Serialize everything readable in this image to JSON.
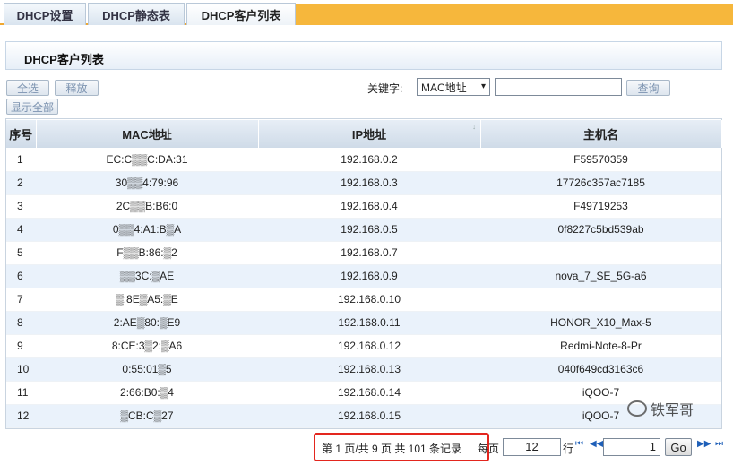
{
  "tabs": [
    "DHCP设置",
    "DHCP静态表",
    "DHCP客户列表"
  ],
  "panel_title": "DHCP客户列表",
  "toolbar": {
    "select_all": "全选",
    "release": "释放",
    "show_all": "显示全部",
    "keyword_label": "关键字:",
    "keyword_option": "MAC地址",
    "keyword_value": "",
    "query": "查询"
  },
  "table": {
    "headers": [
      "序号",
      "MAC地址",
      "IP地址",
      "主机名"
    ],
    "rows": [
      {
        "idx": "1",
        "mac": "EC:C▒▒C:DA:31",
        "ip": "192.168.0.2",
        "host": "F59570359"
      },
      {
        "idx": "2",
        "mac": "30▒▒4:79:96",
        "ip": "192.168.0.3",
        "host": "17726c357ac7185"
      },
      {
        "idx": "3",
        "mac": "2C▒▒B:B6:0",
        "ip": "192.168.0.4",
        "host": "F49719253"
      },
      {
        "idx": "4",
        "mac": "0▒▒4:A1:B▒A",
        "ip": "192.168.0.5",
        "host": "0f8227c5bd539ab"
      },
      {
        "idx": "5",
        "mac": "F▒▒B:86:▒2",
        "ip": "192.168.0.7",
        "host": ""
      },
      {
        "idx": "6",
        "mac": "▒▒3C:▒AE",
        "ip": "192.168.0.9",
        "host": "nova_7_SE_5G-a6"
      },
      {
        "idx": "7",
        "mac": "▒:8E▒A5:▒E",
        "ip": "192.168.0.10",
        "host": ""
      },
      {
        "idx": "8",
        "mac": "2:AE▒80:▒E9",
        "ip": "192.168.0.11",
        "host": "HONOR_X10_Max-5"
      },
      {
        "idx": "9",
        "mac": "8:CE:3▒2:▒A6",
        "ip": "192.168.0.12",
        "host": "Redmi-Note-8-Pr"
      },
      {
        "idx": "10",
        "mac": "0:55:01▒5",
        "ip": "192.168.0.13",
        "host": "040f649cd3163c6"
      },
      {
        "idx": "11",
        "mac": "2:66:B0:▒4",
        "ip": "192.168.0.14",
        "host": "iQOO-7"
      },
      {
        "idx": "12",
        "mac": "▒CB:C▒27",
        "ip": "192.168.0.15",
        "host": "iQOO-7"
      }
    ]
  },
  "footer": {
    "page_info": "第 1 页/共 9 页 共 101 条记录",
    "per_page_label": "每页",
    "per_page_value": "12",
    "rows_label": "行",
    "page_value": "1",
    "go_label": "Go"
  },
  "watermark": "铁军哥",
  "colors": {
    "tab_accent": "#f6b73c",
    "header_bg": "#dbe5f0",
    "alt_row": "#eaf2fb",
    "highlight_box": "#e3261e"
  }
}
